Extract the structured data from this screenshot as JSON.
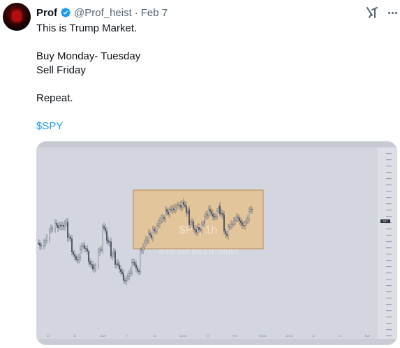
{
  "tweet": {
    "author_name": "Prof",
    "author_handle": "@Prof_heist",
    "separator": "·",
    "date": "Feb 7",
    "lines": [
      "This is Trump Market.",
      "Buy Monday- Tuesday",
      "Sell Friday",
      "Repeat."
    ],
    "cashtag": "$SPY"
  },
  "icons": {
    "avatar": "avatar-image",
    "verified": "verified-badge-icon",
    "grok": "grok-icon",
    "more": "more-icon"
  },
  "colors": {
    "verified": "#1d9bf0",
    "cashtag": "#1d9bf0",
    "chart_bg": "#d3d6de",
    "highlight_box": "#e3c59b",
    "candles": "#4a5060"
  },
  "media": {
    "type": "chart-screenshot",
    "highlight_label": "$PY, 1h",
    "highlight_sublabel": "SPDR S&P 500 ETF TRUST",
    "price_badge": "SPY",
    "x_tick_labels": [
      "13",
      "17",
      "2025",
      "7",
      "13",
      "15:00",
      "27",
      "Feb",
      "03:00",
      "15:00",
      "11",
      "17",
      "Mar"
    ]
  }
}
